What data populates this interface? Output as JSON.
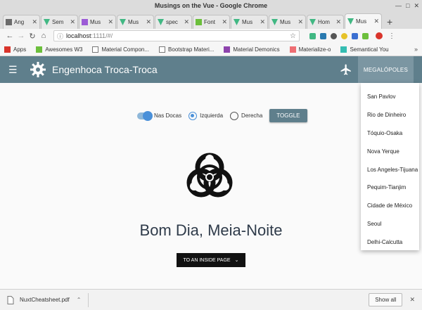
{
  "window": {
    "title": "Musings on the Vue - Google Chrome"
  },
  "tabs": [
    {
      "label": "Ang",
      "icon": "document-icon",
      "color": "#6b6b6b"
    },
    {
      "label": "Sem",
      "icon": "vue-icon",
      "color": "#41b883"
    },
    {
      "label": "Mus",
      "icon": "m-icon",
      "color": "#9c5bd6"
    },
    {
      "label": "Mus",
      "icon": "vue-icon",
      "color": "#41b883"
    },
    {
      "label": "spec",
      "icon": "vue-icon",
      "color": "#41b883"
    },
    {
      "label": "Font",
      "icon": "font-icon",
      "color": "#6cbf3c"
    },
    {
      "label": "Mus",
      "icon": "vue-icon",
      "color": "#41b883"
    },
    {
      "label": "Mus",
      "icon": "vue-icon",
      "color": "#41b883"
    },
    {
      "label": "Hom",
      "icon": "vue-icon",
      "color": "#41b883"
    },
    {
      "label": "Mus",
      "icon": "vue-icon",
      "color": "#41b883",
      "active": true
    }
  ],
  "toolbar": {
    "url_host": "localhost",
    "url_path": ":1111/#/"
  },
  "bookmarks": [
    {
      "label": "Apps",
      "icon": "apps-icon"
    },
    {
      "label": "Awesomes W3",
      "icon": "w3-icon"
    },
    {
      "label": "Material Compon...",
      "icon": "document-icon"
    },
    {
      "label": "Bootstrap Materi...",
      "icon": "document-icon"
    },
    {
      "label": "Material Demonics",
      "icon": "mdemonics-icon"
    },
    {
      "label": "Materialize-o",
      "icon": "materialize-icon"
    },
    {
      "label": "Semantical You",
      "icon": "semantic-icon"
    }
  ],
  "appbar": {
    "title": "Engenhoca Troca-Troca",
    "menu_label": "MEGALÓPOLES",
    "color": "#5f7f8c"
  },
  "controls": {
    "switch_label": "Nas Docas",
    "radio_left": "Izquierda",
    "radio_right": "Derecha",
    "toggle_label": "TOGGLE"
  },
  "main": {
    "greeting": "Bom Dia, Meia-Noite",
    "inside_button": "TO AN INSIDE PAGE"
  },
  "dropdown": {
    "items": [
      "San Pavlov",
      "Rio de Dinheiro",
      "Tóquio-Osaka",
      "Nova Yerque",
      "Los Angeles-Tijuana",
      "Pequim-Tianjim",
      "Cidade de México",
      "Seoul",
      "Delhi-Calcutta"
    ]
  },
  "download": {
    "filename": "NuxtCheatsheet.pdf",
    "show_all": "Show all"
  }
}
